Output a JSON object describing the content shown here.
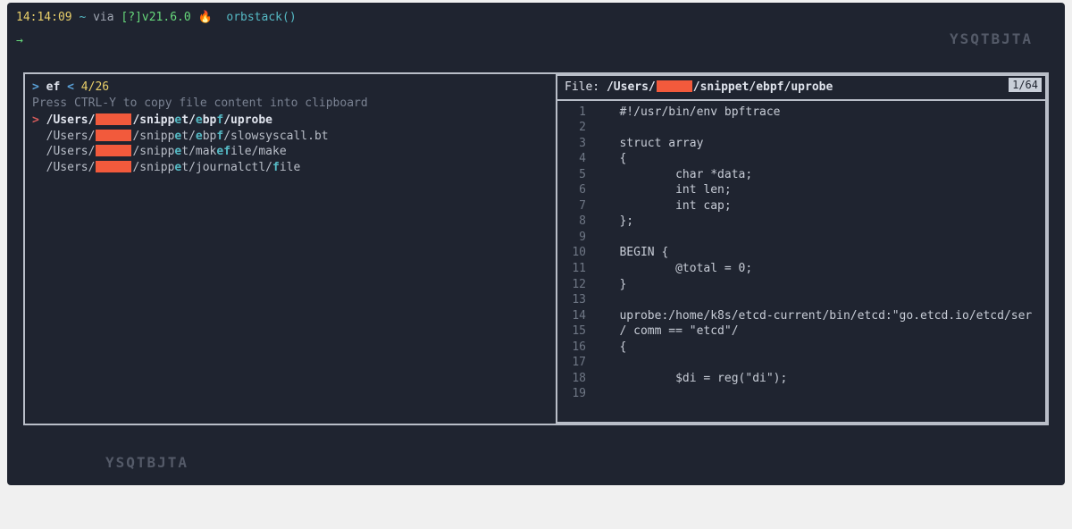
{
  "prompt": {
    "time": "14:14:09",
    "tilde": "~",
    "via": "via",
    "versionBox": "[?]",
    "version": "v21.6.0",
    "fire": "🔥",
    "orb": "orbstack()",
    "arrow": "→"
  },
  "fzf": {
    "chevron": ">",
    "query": "ef",
    "lt": "<",
    "count": "4/26",
    "hint": "Press CTRL-Y to copy file content into clipboard",
    "results": [
      {
        "selected": true,
        "pre": "/Users/",
        "post": "/snipp",
        "m1": "e",
        "rest1": "t/",
        "m2": "e",
        "rest2": "bp",
        "m3": "f",
        "tail": "/uprobe"
      },
      {
        "selected": false,
        "pre": "/Users/",
        "post": "/snipp",
        "m1": "e",
        "rest1": "t/",
        "m2": "e",
        "rest2": "bp",
        "m3": "f",
        "tail": "/slowsyscall.bt"
      },
      {
        "selected": false,
        "pre": "/Users/",
        "post": "/snipp",
        "m1": "e",
        "rest1": "t/mak",
        "m2": "e",
        "rest2": "",
        "m3": "f",
        "tail": "ile/make"
      },
      {
        "selected": false,
        "pre": "/Users/",
        "post": "/snipp",
        "m1": "e",
        "rest1": "t/journalctl/",
        "m2": "",
        "rest2": "",
        "m3": "f",
        "tail": "ile"
      }
    ]
  },
  "preview": {
    "fileLabel": "File:",
    "pathPre": "/Users/",
    "pathPost": "/snippet/ebpf/uprobe",
    "badge": "1/64",
    "lines": [
      "#!/usr/bin/env bpftrace",
      "",
      "struct array",
      "{",
      "        char *data;",
      "        int len;",
      "        int cap;",
      "};",
      "",
      "BEGIN {",
      "        @total = 0;",
      "}",
      "",
      "uprobe:/home/k8s/etcd-current/bin/etcd:\"go.etcd.io/etcd/ser",
      "/ comm == \"etcd\"/",
      "{",
      "",
      "        $di = reg(\"di\");",
      ""
    ]
  },
  "watermark": "YSQTBJTA"
}
